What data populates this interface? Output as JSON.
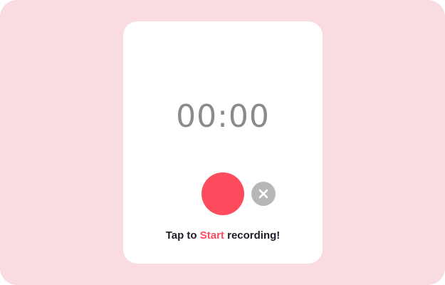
{
  "recorder": {
    "timer": "00:00",
    "hint_prefix": "Tap to ",
    "hint_action": "Start",
    "hint_suffix": " recording!"
  },
  "icons": {
    "record": "record-icon",
    "cancel": "close-icon"
  },
  "colors": {
    "background": "#f8dce0",
    "card": "#ffffff",
    "accent": "#ff4b5e",
    "timer_text": "#8a8a8a",
    "cancel_button": "#b7b7b7",
    "hint_text": "#1d1d2b"
  }
}
